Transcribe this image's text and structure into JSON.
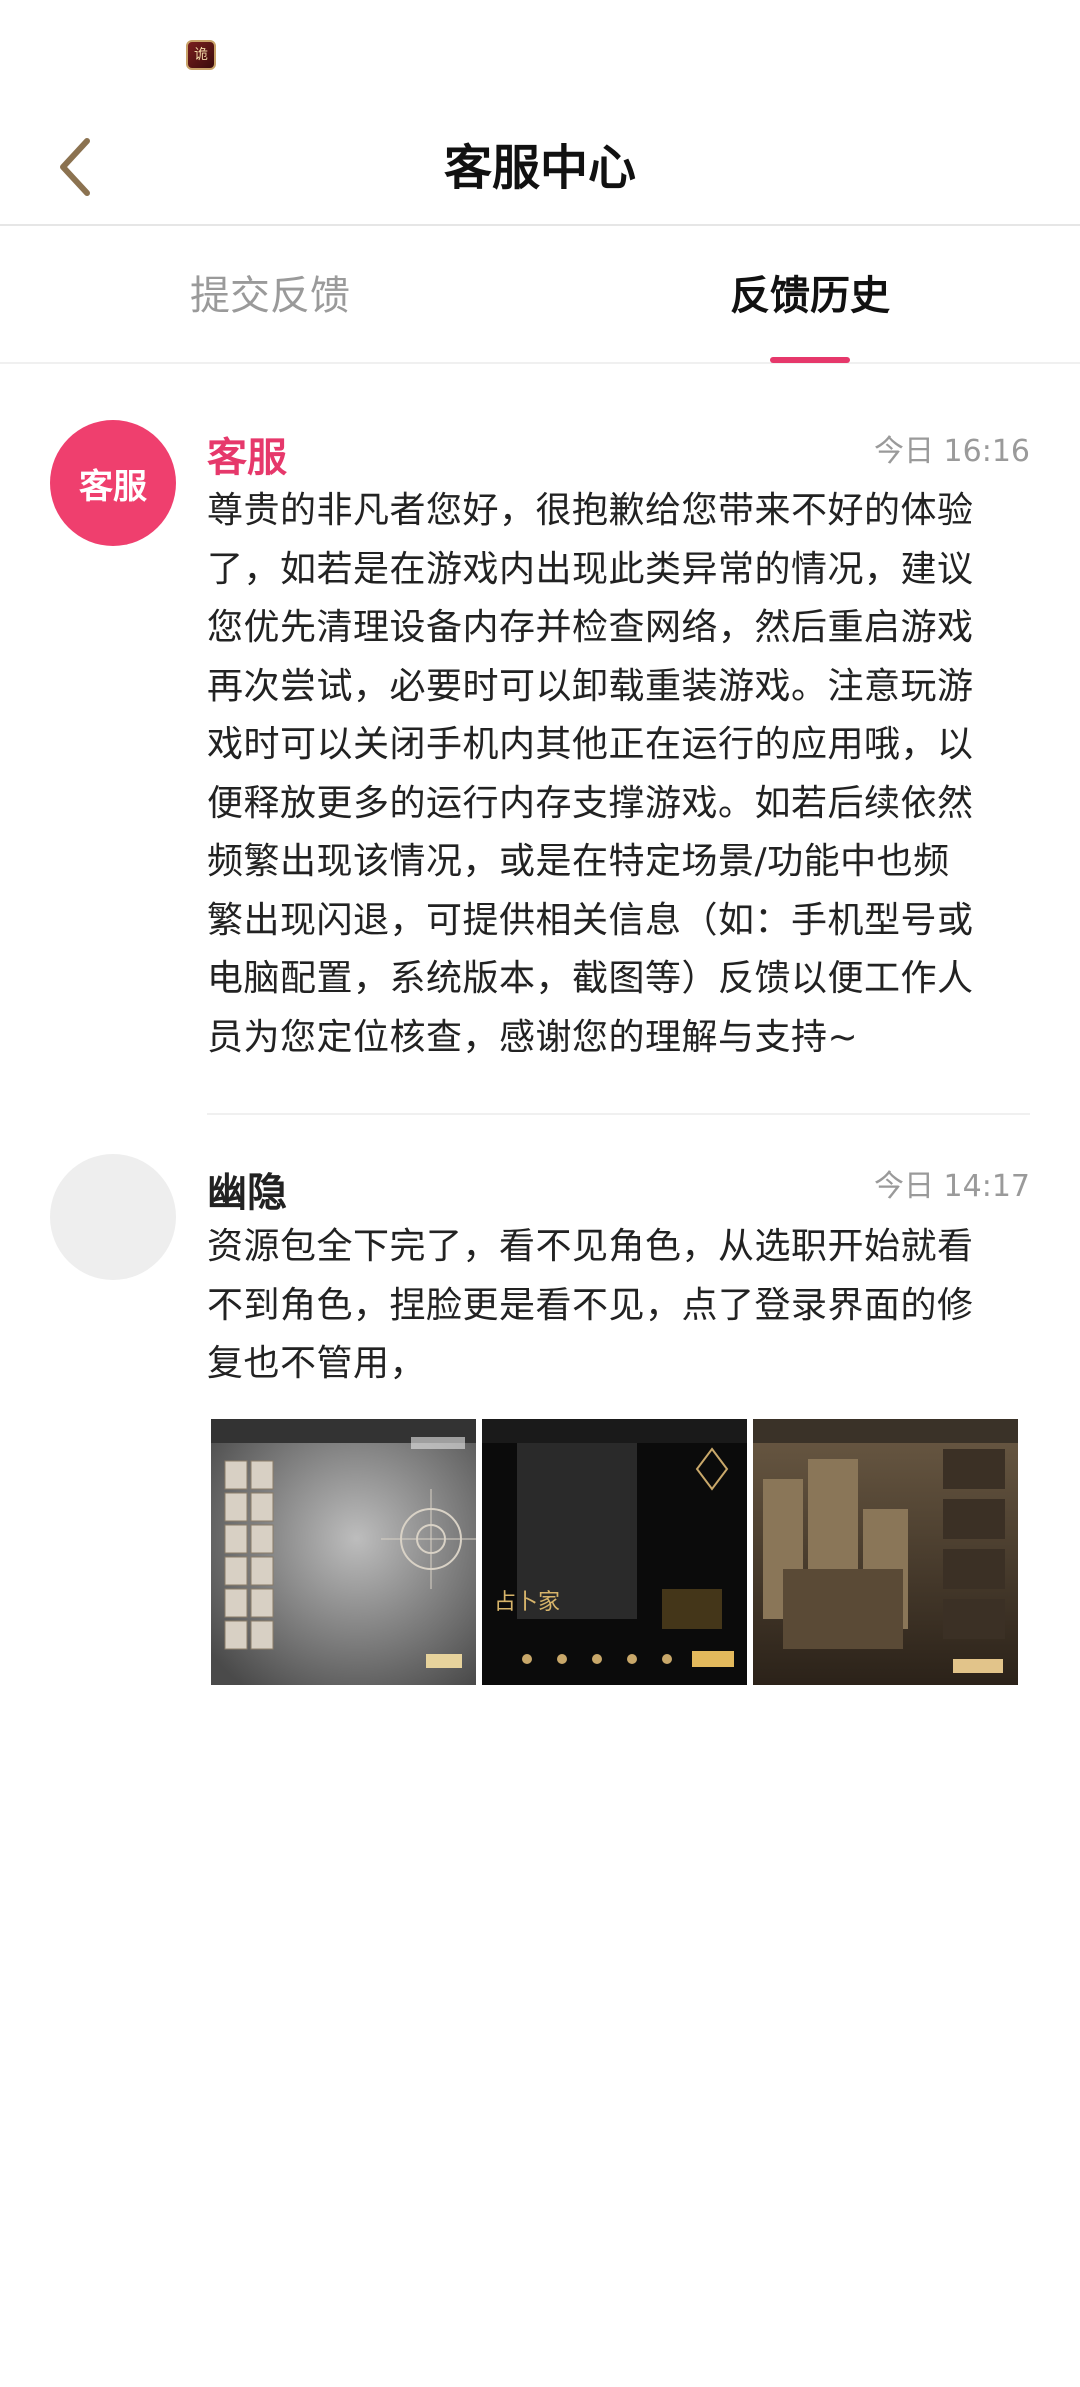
{
  "status_bar": {
    "app_icon": "game-app-icon"
  },
  "header": {
    "title": "客服中心",
    "back_icon": "chevron-left-icon"
  },
  "tabs": [
    {
      "label": "提交反馈",
      "active": false
    },
    {
      "label": "反馈历史",
      "active": true
    }
  ],
  "messages": [
    {
      "avatar_text": "客服",
      "sender": "客服",
      "time": "今日 16:16",
      "lines": [
        "尊贵的非凡者您好，很抱歉给您带来不好的体验",
        "了，如若是在游戏内出现此类异常的情况，建议",
        "您优先清理设备内存并检查网络，然后重启游戏",
        "再次尝试，必要时可以卸载重装游戏。注意玩游",
        "戏时可以关闭手机内其他正在运行的应用哦，以",
        "便释放更多的运行内存支撑游戏。如若后续依然",
        "频繁出现该情况，或是在特定场景/功能中也频",
        "繁出现闪退，可提供相关信息（如：手机型号或",
        "电脑配置，系统版本，截图等）反馈以便工作人",
        "员为您定位核查，感谢您的理解与支持~"
      ]
    },
    {
      "sender": "幽隐",
      "time": "今日 14:17",
      "lines": [
        "资源包全下完了，看不见角色，从选职开始就看",
        "不到角色，捏脸更是看不见，点了登录界面的修",
        "复也不管用，"
      ],
      "attachments": [
        "screenshot-character-select",
        "screenshot-dark-scene",
        "screenshot-city-scene"
      ]
    }
  ],
  "colors": {
    "accent": "#e6386b",
    "back_arrow": "#8b7250",
    "muted": "#9a9a9a"
  }
}
